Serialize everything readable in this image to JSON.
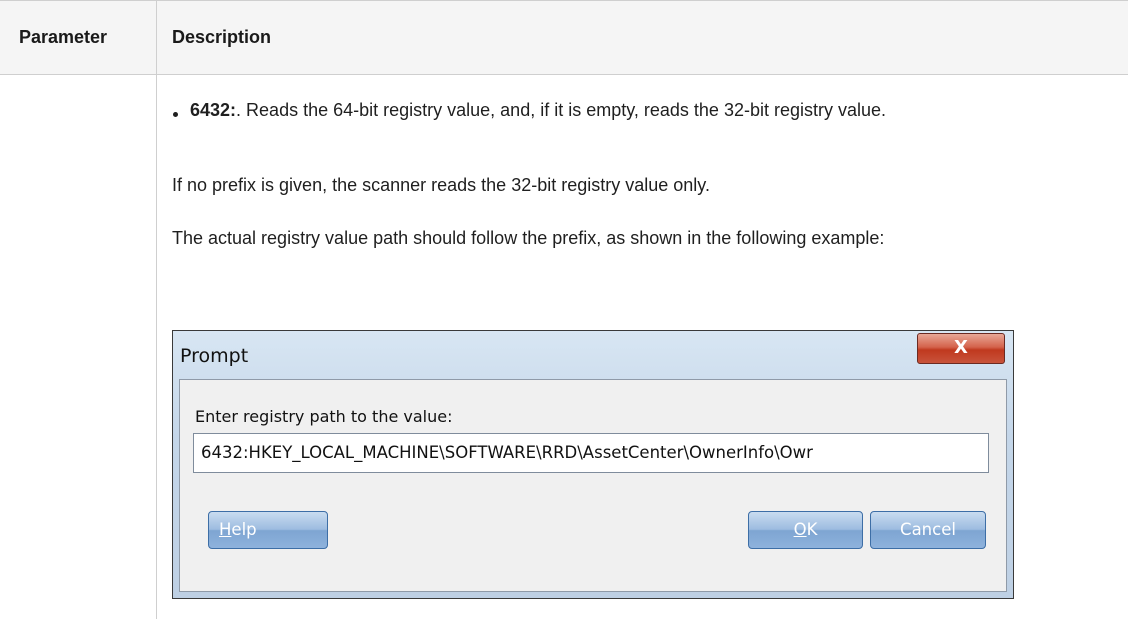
{
  "table": {
    "header": {
      "parameter": "Parameter",
      "description": "Description"
    },
    "row": {
      "bullet": {
        "term": "6432:",
        "text": ". Reads the 64-bit registry value, and, if it is empty, reads the 32-bit registry value."
      },
      "paragraphs": [
        "If no prefix is given, the scanner reads the 32-bit registry value only.",
        "The actual registry value path should follow the prefix, as shown in the following example:"
      ]
    }
  },
  "dialog": {
    "title": "Prompt",
    "close_label": "X",
    "label": "Enter registry path to the value:",
    "input_value": "6432:HKEY_LOCAL_MACHINE\\SOFTWARE\\RRD\\AssetCenter\\OwnerInfo\\Owr",
    "help_mnemonic": "H",
    "help_rest": "elp",
    "ok_mnemonic": "O",
    "ok_rest": "K",
    "cancel_label": "Cancel"
  }
}
